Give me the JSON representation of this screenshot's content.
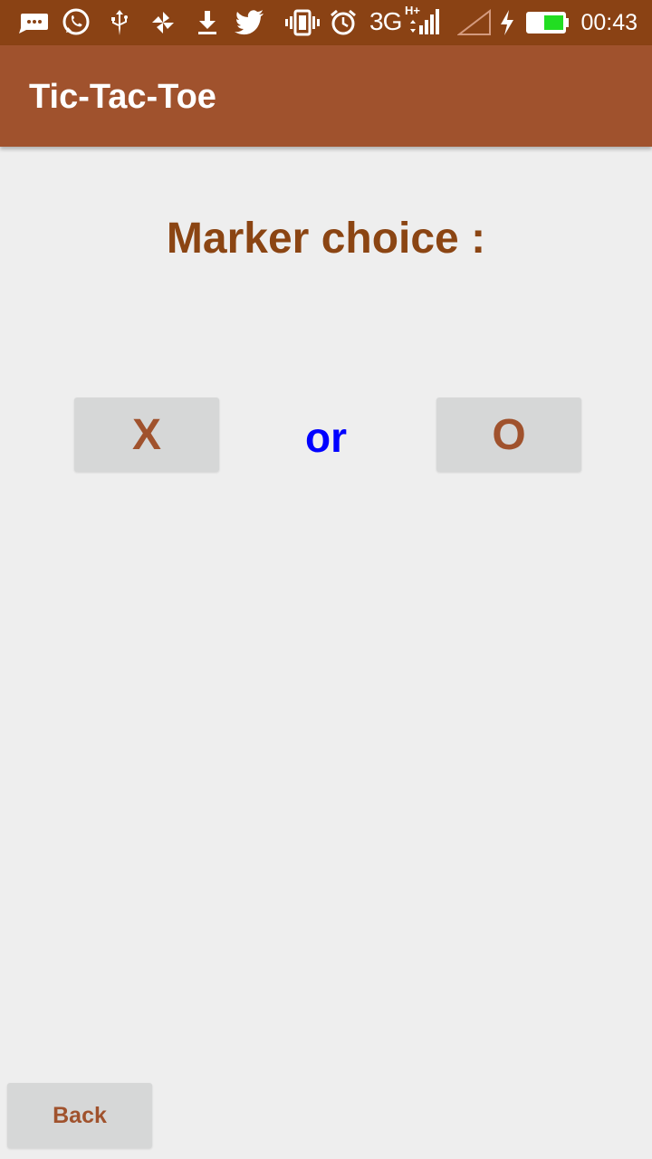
{
  "status_bar": {
    "icons": [
      "message-icon",
      "whatsapp-icon",
      "usb-icon",
      "pinwheel-icon",
      "download-icon",
      "twitter-icon",
      "vibrate-icon",
      "alarm-icon",
      "network-icon",
      "signal-icon",
      "no-signal-icon",
      "charging-icon",
      "battery-icon"
    ],
    "network": "3G",
    "network_sup": "H+",
    "time": "00:43",
    "battery_color": "#22dd22"
  },
  "app_bar": {
    "title": "Tic-Tac-Toe",
    "color": "#a0522d"
  },
  "main": {
    "heading": "Marker choice :",
    "option_x": "X",
    "separator": "or",
    "option_o": "O"
  },
  "footer": {
    "back_label": "Back"
  },
  "colors": {
    "heading": "#8b4513",
    "separator": "#0000ff",
    "button_text": "#a0522d",
    "button_bg": "#d6d7d7",
    "background": "#eeeeee",
    "status_bar": "#8a4214"
  }
}
